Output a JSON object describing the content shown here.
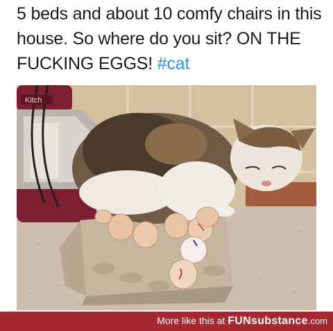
{
  "tweet": {
    "text": "5 beds and about 10 comfy chairs in this house. So where do you sit? ON THE FUCKING EGGS!",
    "hashtag": "#cat"
  },
  "photo": {
    "mixer_badge": "Kitch",
    "colors": {
      "tile": "#d8c6a8",
      "counter": "#cfc0ae",
      "carton": "#c8b7a2",
      "mixer": "#7d1f30"
    }
  },
  "footer": {
    "prefix": "More like this at",
    "brand": "FUNsubstance",
    "suffix": ".com",
    "background": "#a8282f"
  }
}
